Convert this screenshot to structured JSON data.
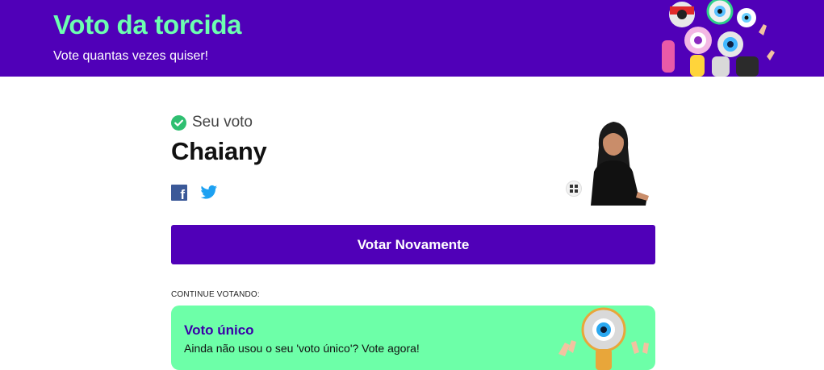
{
  "header": {
    "title": "Voto da torcida",
    "subtitle": "Vote quantas vezes quiser!"
  },
  "vote": {
    "status_label": "Seu voto",
    "candidate_name": "Chaiany"
  },
  "share": {
    "facebook_icon": "facebook-icon",
    "twitter_icon": "twitter-icon"
  },
  "actions": {
    "vote_again_label": "Votar Novamente"
  },
  "continue_section": {
    "label": "CONTINUE VOTANDO:"
  },
  "promo": {
    "title": "Voto único",
    "text": "Ainda não usou o seu 'voto único'? Vote agora!"
  },
  "colors": {
    "brand_purple": "#5000b8",
    "accent_green": "#6dffb0",
    "check_green": "#2fbf71"
  }
}
